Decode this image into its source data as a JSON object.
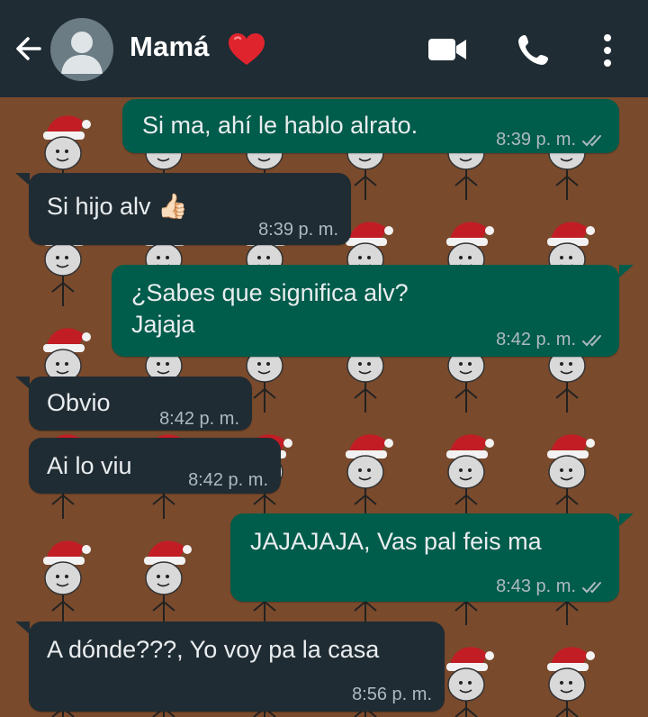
{
  "header": {
    "contact_name": "Mamá",
    "heart_emoji": "❤️"
  },
  "messages": [
    {
      "direction": "outgoing",
      "text": "Si ma, ahí le hablo alrato.",
      "time": "8:39 p. m.",
      "status": "read"
    },
    {
      "direction": "incoming",
      "text": "Si hijo alv 👍🏻",
      "time": "8:39 p. m."
    },
    {
      "direction": "outgoing",
      "text": "¿Sabes que significa alv?\nJajaja",
      "time": "8:42 p. m.",
      "status": "read"
    },
    {
      "direction": "incoming",
      "text": "Obvio",
      "time": "8:42 p. m."
    },
    {
      "direction": "incoming",
      "text": "Ai lo viu",
      "time": "8:42 p. m."
    },
    {
      "direction": "outgoing",
      "text": "JAJAJAJA, Vas pal feis ma",
      "time": "8:43 p. m.",
      "status": "read"
    },
    {
      "direction": "incoming",
      "text": "A dónde???, Yo voy pa la casa",
      "time": "8:56 p. m."
    }
  ],
  "colors": {
    "header_bg": "#1f2c34",
    "outgoing_bubble": "#005c4b",
    "incoming_bubble": "#202c33",
    "wallpaper": "#7a4a2c",
    "read_ticks": "#aebac1"
  }
}
